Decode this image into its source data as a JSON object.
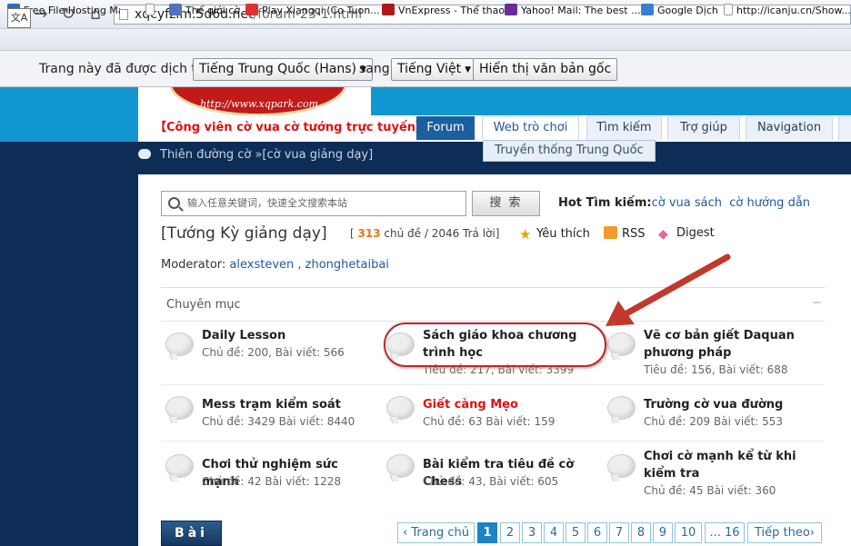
{
  "browser": {
    "url_host": "xqcyfzlm.5d6d.net",
    "url_path": "/forum-23-1.html",
    "bookmarks": [
      "Free File Hosting Mad",
      "Thế giới cờ",
      "Play Xiangqi (Co Tuon...",
      "VnExpress - Thể thao",
      "Yahoo! Mail: The best ...",
      "Google Dịch",
      "http://icanju.cn/Show..."
    ]
  },
  "translate_bar": {
    "prefix": "Trang này đã được dịch từ",
    "from_lang": "Tiếng Trung Quốc (Hans)",
    "middle": "sang",
    "to_lang": "Tiếng Việt",
    "show_original": "Hiển thị văn bản gốc"
  },
  "logo_text": "http://www.xqpark.com",
  "nav": {
    "brand": "【Công viên cờ vua cờ tướng trực tuyến】",
    "forum": "Forum",
    "web": "Web trò chơi",
    "search": "Tìm kiếm",
    "help": "Trợ giúp",
    "navigation": "Navigation",
    "dropdown_item": "Truyền thống Trung Quốc"
  },
  "breadcrumb": "Thiên đường cờ »[cờ vua giảng dạy]",
  "search": {
    "placeholder": "输入任意关键词，快速全文搜索本站",
    "button": "搜 索",
    "hot_label": "Hot Tìm kiếm:",
    "hot_links": [
      "cờ vua sách",
      "cờ hướng dẫn"
    ]
  },
  "forum": {
    "title": "[Tướng Kỳ giảng dạy]",
    "stats_open": "[",
    "topics": "313",
    "stats_rest": "chủ đề / 2046 Trả lời]",
    "favorite": "Yêu thích",
    "rss": "RSS",
    "digest": "Digest",
    "moderator_label": "Moderator:",
    "moderators": "alexsteven , zhonghetaibai"
  },
  "category": {
    "title": "Chuyên mục",
    "collapse": "−",
    "boards": [
      {
        "name": "Daily Lesson",
        "stat": "Chủ đề: 200, Bài viết: 566"
      },
      {
        "name": "Sách giáo khoa chương trình học",
        "stat": "Tiêu đề: 217, Bài viết: 3399"
      },
      {
        "name": "Vẽ cơ bản giết Daquan phương pháp",
        "stat": "Tiêu đề: 156, Bài viết: 688"
      },
      {
        "name": "Mess trạm kiểm soát",
        "stat": "Chủ đề: 3429 Bài viết: 8440"
      },
      {
        "name": "Giết càng Mẹo",
        "stat": "Chủ đề: 63 Bài viết: 159"
      },
      {
        "name": "Trường cờ vua đường",
        "stat": "Chủ đề: 209 Bài viết: 553"
      },
      {
        "name": "Chơi thử nghiệm sức mạnh",
        "stat": "Chủ đề: 42 Bài viết: 1228"
      },
      {
        "name": "Bài kiểm tra tiêu đề cờ Chess",
        "stat": "Chủ đề: 43, Bài viết: 605"
      },
      {
        "name": "Chơi cờ mạnh kể từ khi kiểm tra",
        "stat": "Chủ đề: 45 Bài viết: 360"
      }
    ]
  },
  "bottom": {
    "post_button": "Bài",
    "prev": "‹ Trang chủ",
    "pages": [
      "1",
      "2",
      "3",
      "4",
      "5",
      "6",
      "7",
      "8",
      "9",
      "10",
      "... 16"
    ],
    "next": "Tiếp theo›"
  },
  "colors": {
    "accent": "#1397d1",
    "link": "#2159a2",
    "highlight": "#b52b2b"
  }
}
